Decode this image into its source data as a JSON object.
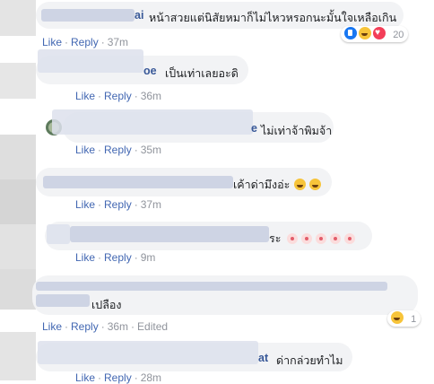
{
  "comments": [
    {
      "name_suffix": "ai",
      "text": "หน้าสวยแต่นิสัยหมาก็ไม่ไหวหรอกนะมั้นใจเหลือเกิน",
      "like": "Like",
      "reply": "Reply",
      "time": "37m",
      "reaction_count": "20"
    },
    {
      "name_suffix": "oe",
      "text": "เป็นเท่าเลยอะดิ",
      "like": "Like",
      "reply": "Reply",
      "time": "36m"
    },
    {
      "name_suffix": "e",
      "text": "ไม่เท่าจ้าพิมจ้า",
      "like": "Like",
      "reply": "Reply",
      "time": "35m"
    },
    {
      "text": "เค้าด่ามึงอ่ะ",
      "like": "Like",
      "reply": "Reply",
      "time": "37m"
    },
    {
      "text": "ระ",
      "like": "Like",
      "reply": "Reply",
      "time": "9m"
    },
    {
      "text": "เปลือง",
      "like": "Like",
      "reply": "Reply",
      "time": "36m",
      "edited": "Edited",
      "reaction_count": "1"
    },
    {
      "name_suffix": "at",
      "text": "ด่ากล่วยทำไม",
      "like": "Like",
      "reply": "Reply",
      "time": "28m"
    }
  ],
  "separator": "·",
  "colors": {
    "link": "#4267b2",
    "name": "#385898",
    "meta": "#90949c",
    "bubble": "#f2f3f5"
  }
}
